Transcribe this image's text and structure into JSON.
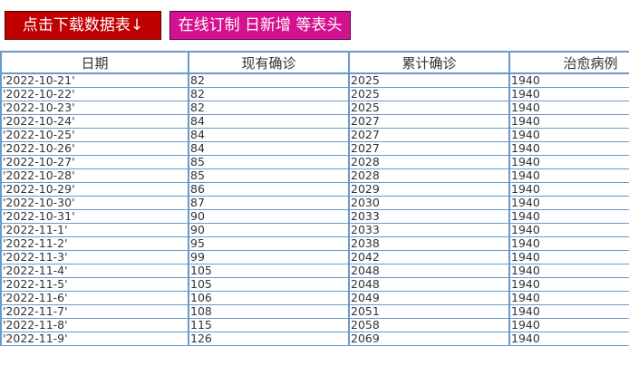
{
  "toolbar": {
    "download_label": "点击下载数据表↓",
    "custom_label": "在线订制 日新增 等表头"
  },
  "table": {
    "headers": [
      "日期",
      "现有确诊",
      "累计确诊",
      "治愈病例"
    ],
    "rows": [
      [
        "'2022-10-21'",
        "82",
        "2025",
        "1940"
      ],
      [
        "'2022-10-22'",
        "82",
        "2025",
        "1940"
      ],
      [
        "'2022-10-23'",
        "82",
        "2025",
        "1940"
      ],
      [
        "'2022-10-24'",
        "84",
        "2027",
        "1940"
      ],
      [
        "'2022-10-25'",
        "84",
        "2027",
        "1940"
      ],
      [
        "'2022-10-26'",
        "84",
        "2027",
        "1940"
      ],
      [
        "'2022-10-27'",
        "85",
        "2028",
        "1940"
      ],
      [
        "'2022-10-28'",
        "85",
        "2028",
        "1940"
      ],
      [
        "'2022-10-29'",
        "86",
        "2029",
        "1940"
      ],
      [
        "'2022-10-30'",
        "87",
        "2030",
        "1940"
      ],
      [
        "'2022-10-31'",
        "90",
        "2033",
        "1940"
      ],
      [
        "'2022-11-1'",
        "90",
        "2033",
        "1940"
      ],
      [
        "'2022-11-2'",
        "95",
        "2038",
        "1940"
      ],
      [
        "'2022-11-3'",
        "99",
        "2042",
        "1940"
      ],
      [
        "'2022-11-4'",
        "105",
        "2048",
        "1940"
      ],
      [
        "'2022-11-5'",
        "105",
        "2048",
        "1940"
      ],
      [
        "'2022-11-6'",
        "106",
        "2049",
        "1940"
      ],
      [
        "'2022-11-7'",
        "108",
        "2051",
        "1940"
      ],
      [
        "'2022-11-8'",
        "115",
        "2058",
        "1940"
      ],
      [
        "'2022-11-9'",
        "126",
        "2069",
        "1940"
      ]
    ]
  },
  "colors": {
    "download_button_bg": "#c00000",
    "custom_button_bg": "#d4118f",
    "grid_border": "#6699cc"
  }
}
